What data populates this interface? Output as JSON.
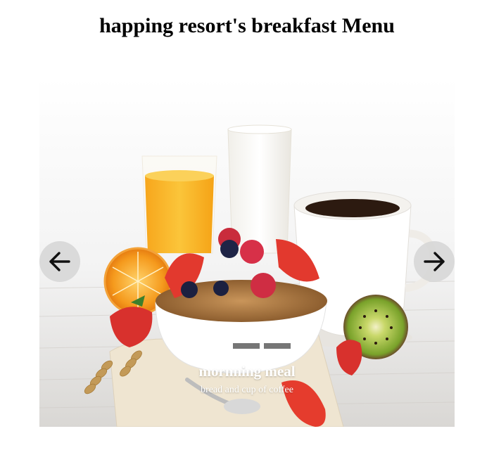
{
  "page": {
    "title": "happing resort's breakfast Menu"
  },
  "carousel": {
    "prev_icon": "arrow-left-icon",
    "next_icon": "arrow-right-icon",
    "indicator_count": 3,
    "active_indicator": 1,
    "slide": {
      "image": "breakfast-cereal-bowl-with-berries-juice-milk-coffee-kiwi",
      "caption_title": "mornning meal",
      "caption_text": "bread and cup of coffee"
    }
  },
  "colors": {
    "control_bg": "#d6d6d6",
    "indicator_active": "#f2f2f2",
    "indicator_inactive": "#505050",
    "caption_text": "#ffffff"
  }
}
